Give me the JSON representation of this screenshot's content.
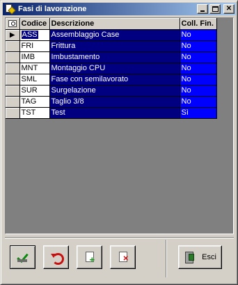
{
  "window": {
    "title": "Fasi di lavorazione",
    "controls": {
      "minimize": "_",
      "maximize": "□",
      "close": "✕"
    }
  },
  "grid": {
    "corner_icon": "search-icon",
    "columns": [
      "Codice",
      "Descrizione",
      "Coll. Fin."
    ],
    "current_row_marker": "▶",
    "rows": [
      {
        "code": "ASS",
        "description": "Assemblaggio Case",
        "coll_fin": "No"
      },
      {
        "code": "FRI",
        "description": "Frittura",
        "coll_fin": "No"
      },
      {
        "code": "IMB",
        "description": "Imbustamento",
        "coll_fin": "No"
      },
      {
        "code": "MNT",
        "description": "Montaggio CPU",
        "coll_fin": "No"
      },
      {
        "code": "SML",
        "description": "Fase con semilavorato",
        "coll_fin": "No"
      },
      {
        "code": "SUR",
        "description": "Surgelazione",
        "coll_fin": "No"
      },
      {
        "code": "TAG",
        "description": "Taglio 3/8",
        "coll_fin": "No"
      },
      {
        "code": "TST",
        "description": "Test",
        "coll_fin": "Sì"
      }
    ]
  },
  "toolbar": {
    "confirm_icon": "check-icon",
    "undo_icon": "undo-icon",
    "add_icon": "add-document-icon",
    "delete_icon": "delete-document-icon",
    "exit_icon": "exit-door-icon",
    "exit_label": "Esci"
  },
  "colors": {
    "selection": "#000080",
    "highlight": "#0000ff",
    "face": "#d4d0c8"
  }
}
